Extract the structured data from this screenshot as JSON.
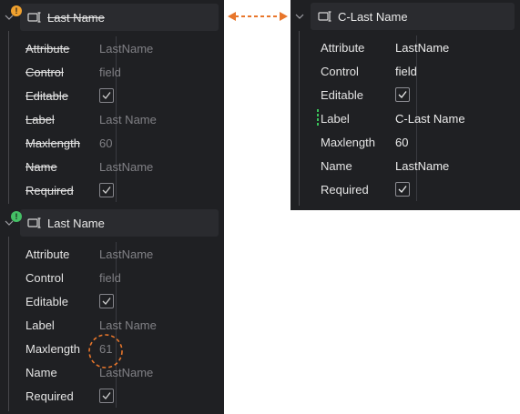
{
  "left_top_node": {
    "title": "Last Name",
    "badge": "!",
    "rows": [
      {
        "label": "Attribute",
        "value": "LastName"
      },
      {
        "label": "Control",
        "value": "field"
      },
      {
        "label": "Editable",
        "value": ""
      },
      {
        "label": "Label",
        "value": "Last Name"
      },
      {
        "label": "Maxlength",
        "value": "60"
      },
      {
        "label": "Name",
        "value": "LastName"
      },
      {
        "label": "Required",
        "value": ""
      }
    ]
  },
  "left_bottom_node": {
    "title": "Last Name",
    "badge": "!",
    "rows": [
      {
        "label": "Attribute",
        "value": "LastName"
      },
      {
        "label": "Control",
        "value": "field"
      },
      {
        "label": "Editable",
        "value": ""
      },
      {
        "label": "Label",
        "value": "Last Name"
      },
      {
        "label": "Maxlength",
        "value": "61"
      },
      {
        "label": "Name",
        "value": "LastName"
      },
      {
        "label": "Required",
        "value": ""
      }
    ]
  },
  "right_node": {
    "title": "C-Last Name",
    "rows": [
      {
        "label": "Attribute",
        "value": "LastName"
      },
      {
        "label": "Control",
        "value": "field"
      },
      {
        "label": "Editable",
        "value": ""
      },
      {
        "label": "Label",
        "value": "C-Last Name"
      },
      {
        "label": "Maxlength",
        "value": "60"
      },
      {
        "label": "Name",
        "value": "LastName"
      },
      {
        "label": "Required",
        "value": ""
      }
    ]
  },
  "colors": {
    "panel_bg": "#1f2023",
    "header_bg": "#2a2b2f",
    "warning": "#f0a12e",
    "added": "#44c065",
    "change_marker": "#39c45a",
    "annotation": "#e8762b"
  },
  "icons": [
    "chevron-down-icon",
    "node-field-icon",
    "checkmark-icon",
    "warning-badge-icon",
    "added-badge-icon",
    "double-arrow-icon"
  ]
}
